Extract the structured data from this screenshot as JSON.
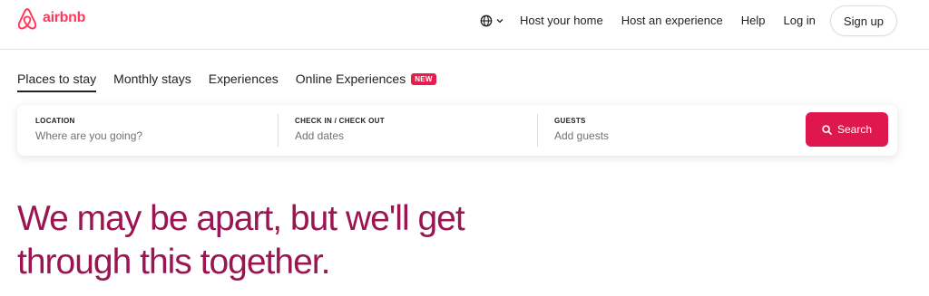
{
  "header": {
    "logo_text": "airbnb",
    "brand_color": "#FF385C",
    "links": [
      "Host your home",
      "Host an experience",
      "Help",
      "Log in"
    ],
    "signup_label": "Sign up",
    "globe_icon": "globe-icon"
  },
  "tabs": [
    {
      "label": "Places to stay",
      "active": true
    },
    {
      "label": "Monthly stays",
      "active": false
    },
    {
      "label": "Experiences",
      "active": false
    },
    {
      "label": "Online Experiences",
      "active": false,
      "badge": "NEW"
    }
  ],
  "search": {
    "location": {
      "label": "LOCATION",
      "placeholder": "Where are you going?"
    },
    "dates": {
      "label": "CHECK IN / CHECK OUT",
      "value": "Add dates"
    },
    "guests": {
      "label": "GUESTS",
      "value": "Add guests"
    },
    "button_label": "Search",
    "button_color": "#E0174F"
  },
  "hero": {
    "line1": "We may be apart, but we'll get",
    "line2": "through this together.",
    "color": "#9C1553"
  }
}
